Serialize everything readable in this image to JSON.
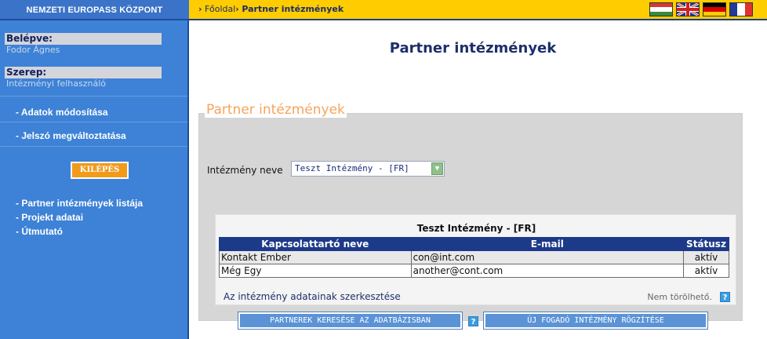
{
  "header": {
    "brand": "NEMZETI EUROPASS KÖZPONT",
    "breadcrumb": {
      "sep1": "›",
      "home": "Főoldal",
      "sep2": "›",
      "current": "Partner intézmények"
    }
  },
  "sidebar": {
    "logged_in_label": "Belépve:",
    "logged_in_user": "Fodor Ágnes",
    "role_label": "Szerep:",
    "role_value": "Intézményi felhasználó",
    "links_account": [
      "- Adatok módosítása",
      "- Jelszó megváltoztatása"
    ],
    "logout_label": "KILÉPÉS",
    "links_nav": [
      "- Partner intézmények listája",
      "- Projekt adatai",
      "- Útmutató"
    ]
  },
  "main": {
    "page_title": "Partner intézmények",
    "legend": "Partner intézmények",
    "institution_label": "Intézmény neve",
    "institution_selected": "Teszt Intézmény - [FR]",
    "panel_title": "Teszt Intézmény - [FR]",
    "table": {
      "headers": [
        "Kapcsolattartó neve",
        "E-mail",
        "Státusz"
      ],
      "rows": [
        [
          "Kontakt Ember",
          "con@int.com",
          "aktív"
        ],
        [
          "Még Egy",
          "another@cont.com",
          "aktív"
        ]
      ]
    },
    "edit_link": "Az intézmény adatainak szerkesztése",
    "not_deletable": "Nem törölhető.",
    "help_symbol": "?",
    "buttons": {
      "search": "PARTNEREK KERESÉSE AZ ADATBÁZISBAN",
      "new": "ÚJ FOGADÓ INTÉZMÉNY RÖGZÍTÉSE"
    }
  }
}
